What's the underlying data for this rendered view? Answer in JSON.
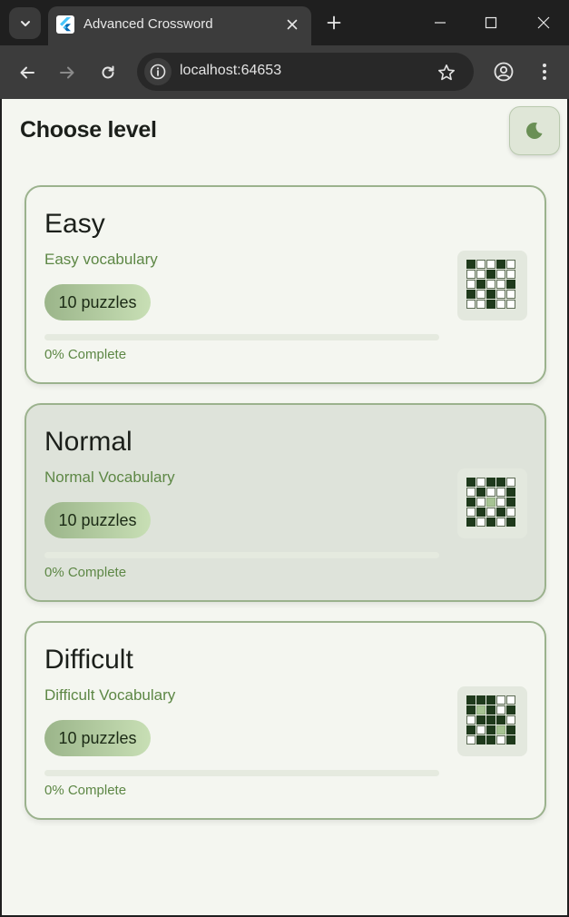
{
  "browser": {
    "tab_title": "Advanced Crossword",
    "url": "localhost:64653"
  },
  "page": {
    "title": "Choose level"
  },
  "levels": [
    {
      "name": "Easy",
      "description": "Easy vocabulary",
      "puzzles_label": "10 puzzles",
      "progress_label": "0% Complete",
      "progress": 0,
      "selected": false,
      "thumbnail": [
        "b..b.",
        "..b..",
        ".b..b",
        "b.b..",
        "..b.."
      ]
    },
    {
      "name": "Normal",
      "description": "Normal Vocabulary",
      "puzzles_label": "10 puzzles",
      "progress_label": "0% Complete",
      "progress": 0,
      "selected": true,
      "thumbnail": [
        "b.bb.",
        ".b..b",
        "b.g.b",
        ".b.b.",
        "b.b.b"
      ]
    },
    {
      "name": "Difficult",
      "description": "Difficult Vocabulary",
      "puzzles_label": "10 puzzles",
      "progress_label": "0% Complete",
      "progress": 0,
      "selected": false,
      "thumbnail": [
        "bbb..",
        "bgb.b",
        ".bbb.",
        "b.bgb",
        ".bb.b"
      ]
    }
  ],
  "colors": {
    "accent": "#5d8745",
    "card_border": "#9bb28d",
    "page_background": "#f4f6f0"
  },
  "icons": {
    "theme_toggle": "moon-icon"
  }
}
